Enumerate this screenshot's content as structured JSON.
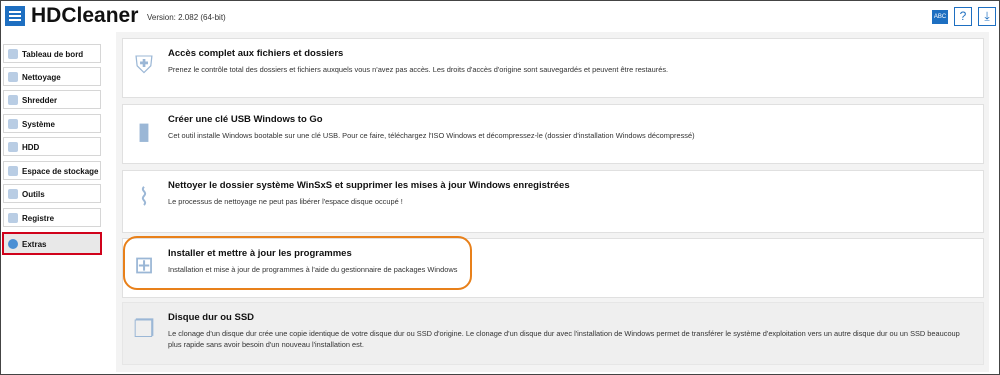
{
  "app": {
    "name": "HDCleaner",
    "version": "Version: 2.082 (64-bit)"
  },
  "toolbar": {
    "icons": [
      "keyboard-icon",
      "help-icon",
      "download-icon"
    ],
    "kb_label": "ABC"
  },
  "sidebar": {
    "items": [
      {
        "label": "Tableau de bord",
        "active": false
      },
      {
        "label": "Nettoyage",
        "active": false
      },
      {
        "label": "Shredder",
        "active": false
      },
      {
        "label": "Système",
        "active": false
      },
      {
        "label": "HDD",
        "active": false
      },
      {
        "label": "Espace de stockage",
        "active": false
      },
      {
        "label": "Outils",
        "active": false
      },
      {
        "label": "Registre",
        "active": false
      },
      {
        "label": "Extras",
        "active": true
      }
    ]
  },
  "cards": [
    {
      "icon": "shield-lock-icon",
      "title": "Accès complet aux fichiers et dossiers",
      "desc": "Prenez le contrôle total des dossiers et fichiers auxquels vous n'avez pas accès. Les droits d'accès d'origine sont sauvegardés et peuvent être restaurés."
    },
    {
      "icon": "usb-icon",
      "title": "Créer une clé USB Windows to Go",
      "desc": "Cet outil installe Windows bootable sur une clé USB. Pour ce faire, téléchargez l'ISO Windows et décompressez-le (dossier d'installation Windows décompressé)"
    },
    {
      "icon": "broom-icon",
      "title": "Nettoyer le dossier système WinSxS et supprimer les mises à jour Windows enregistrées",
      "desc": "Le processus de nettoyage ne peut pas libérer l'espace disque occupé !"
    },
    {
      "icon": "windows-icon",
      "title": "Installer et mettre à jour les programmes",
      "desc": "Installation et mise à jour de programmes à l'aide du gestionnaire de packages Windows"
    },
    {
      "icon": "copy-icon",
      "title": "Disque dur ou SSD",
      "desc": "Le clonage d'un disque dur crée une copie identique de votre disque dur ou SSD d'origine. Le clonage d'un disque dur avec l'installation de Windows permet de transférer le système d'exploitation vers un autre disque dur ou un SSD beaucoup plus rapide sans avoir besoin d'un nouveau l'installation est."
    }
  ],
  "colors": {
    "accent": "#1e6fc1",
    "active_border": "#d0021b",
    "highlight": "#e8801a"
  }
}
